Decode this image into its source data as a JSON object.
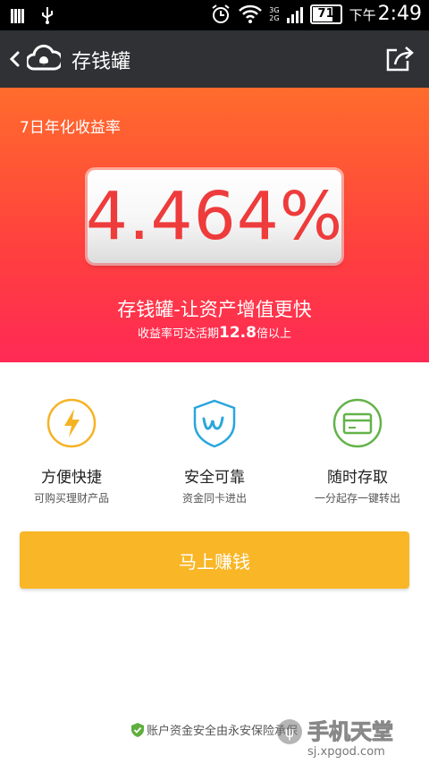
{
  "status_bar": {
    "battery": "71",
    "battery_level": 0.71,
    "network_top": "3G",
    "network_bottom": "2G",
    "time_prefix": "下午",
    "time": "2:49"
  },
  "action_bar": {
    "title": "存钱罐"
  },
  "hero": {
    "yield_label": "7日年化收益率",
    "rate": "4.464%",
    "slogan": "存钱罐-让资产增值更快",
    "sub_prefix": "收益率可达活期",
    "sub_multiple": "12.8",
    "sub_suffix": "倍以上"
  },
  "features": [
    {
      "title": "方便快捷",
      "desc": "可购买理财产品",
      "icon": "lightning-icon",
      "color": "#f5b324"
    },
    {
      "title": "安全可靠",
      "desc": "资金同卡进出",
      "icon": "shield-w-icon",
      "color": "#2aa6dd"
    },
    {
      "title": "随时存取",
      "desc": "一分起存一键转出",
      "icon": "card-icon",
      "color": "#63b348"
    }
  ],
  "cta": {
    "label": "马上赚钱"
  },
  "footer": {
    "text": "账户资金安全由永安保险承保"
  },
  "watermark": {
    "brand": "手机天堂",
    "url": "sj.xpgod.com"
  },
  "colors": {
    "hero_top": "#ff6c2c",
    "hero_bottom": "#ff2a55",
    "rate_text": "#ee3b3b",
    "cta": "#f9b626",
    "action_bar": "#2f3134"
  }
}
